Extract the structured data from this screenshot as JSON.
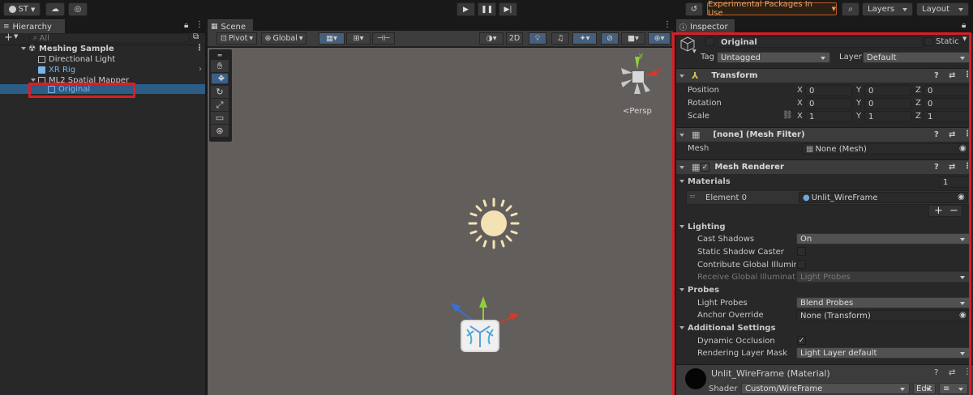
{
  "toolbar": {
    "account_label": "ST",
    "play_icon": "play-icon",
    "pause_icon": "pause-icon",
    "step_icon": "step-icon",
    "experimental_label": "Experimental Packages In Use",
    "layers_label": "Layers",
    "layout_label": "Layout"
  },
  "hierarchy": {
    "tab_label": "Hierarchy",
    "search_placeholder": "All",
    "items": [
      {
        "label": "Meshing Sample"
      },
      {
        "label": "Directional Light"
      },
      {
        "label": "XR Rig"
      },
      {
        "label": "ML2 Spatial Mapper"
      },
      {
        "label": "Original"
      }
    ]
  },
  "scene": {
    "tab_label": "Scene",
    "pivot_label": "Pivot",
    "global_label": "Global",
    "mode_2d_label": "2D",
    "persp_label": "Persp",
    "axis_y": "y",
    "axis_x": "x"
  },
  "inspector": {
    "tab_label": "Inspector",
    "object_name": "Original",
    "static_label": "Static",
    "tag_label": "Tag",
    "tag_value": "Untagged",
    "layer_label": "Layer",
    "layer_value": "Default",
    "transform": {
      "title": "Transform",
      "position_label": "Position",
      "rotation_label": "Rotation",
      "scale_label": "Scale",
      "x_label": "X",
      "y_label": "Y",
      "z_label": "Z",
      "position": [
        "0",
        "0",
        "0"
      ],
      "rotation": [
        "0",
        "0",
        "0"
      ],
      "scale": [
        "1",
        "1",
        "1"
      ]
    },
    "mesh_filter": {
      "title": "[none] (Mesh Filter)",
      "mesh_label": "Mesh",
      "mesh_value": "None (Mesh)"
    },
    "mesh_renderer": {
      "title": "Mesh Renderer",
      "materials_label": "Materials",
      "materials_count": "1",
      "element_label": "Element 0",
      "element_value": "Unlit_WireFrame",
      "plus_label": "+",
      "minus_label": "−",
      "lighting_label": "Lighting",
      "cast_shadows_label": "Cast Shadows",
      "cast_shadows_value": "On",
      "static_shadow_caster_label": "Static Shadow Caster",
      "contribute_gi_label": "Contribute Global Illuminati",
      "receive_gi_label": "Receive Global Illumination",
      "receive_gi_value": "Light Probes",
      "probes_label": "Probes",
      "light_probes_label": "Light Probes",
      "light_probes_value": "Blend Probes",
      "anchor_override_label": "Anchor Override",
      "anchor_override_value": "None (Transform)",
      "additional_label": "Additional Settings",
      "dynamic_occlusion_label": "Dynamic Occlusion",
      "rendering_layer_label": "Rendering Layer Mask",
      "rendering_layer_value": "Light Layer default"
    },
    "material": {
      "title": "Unlit_WireFrame (Material)",
      "shader_label": "Shader",
      "shader_value": "Custom/WireFrame",
      "edit_label": "Edit"
    }
  },
  "colors": {
    "accent_red": "#d61f26",
    "selection": "#2c5d87",
    "prefab_blue": "#7cb4ec",
    "scene_bg": "#625e5b",
    "warning_orange": "#f0a05b"
  }
}
